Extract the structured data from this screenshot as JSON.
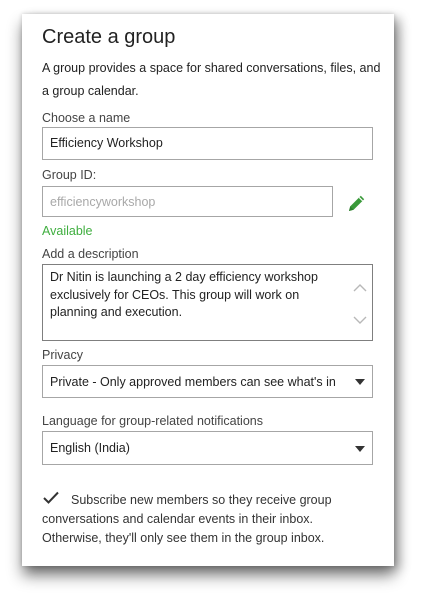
{
  "dialog": {
    "title": "Create a group",
    "description": "A group provides a space for shared conversations, files, and a group calendar."
  },
  "name_field": {
    "label": "Choose a name",
    "value": "Efficiency Workshop"
  },
  "group_id": {
    "label": "Group ID:",
    "placeholder": "efficiencyworkshop",
    "status": "Available",
    "edit_icon": "pencil-icon"
  },
  "description_field": {
    "label": "Add a description",
    "value": "Dr Nitin is launching a 2 day efficiency workshop exclusively for CEOs. This group will work on planning and execution."
  },
  "privacy": {
    "label": "Privacy",
    "selected": "Private - Only approved members can see what's in"
  },
  "language": {
    "label": "Language for group-related notifications",
    "selected": "English (India)"
  },
  "subscribe": {
    "checked": true,
    "text": "Subscribe new members so they receive group conversations and calendar events in their inbox. Otherwise, they'll only see them in the group inbox."
  },
  "colors": {
    "available": "#3fae3f",
    "pencil": "#3a9a3a",
    "border": "#a6a6a6"
  }
}
